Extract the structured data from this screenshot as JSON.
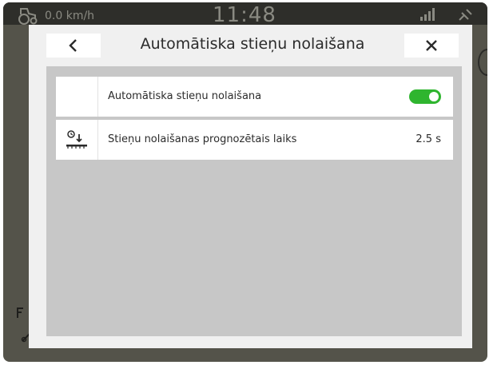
{
  "status": {
    "speed": "0.0 km/h",
    "clock": "11:48"
  },
  "dialog": {
    "title": "Automātiska stieņu nolaišana",
    "rows": [
      {
        "label": "Automātiska stieņu nolaišana",
        "toggle_on": true
      },
      {
        "label": "Stieņu nolaišanas prognozētais laiks",
        "value": "2.5 s"
      }
    ]
  },
  "colors": {
    "toggle_on": "#2fb52f",
    "dialog_bg": "#f0f0f0",
    "content_bg": "#c7c7c7"
  },
  "icons": {
    "back": "chevron-left-icon",
    "close": "close-icon",
    "row2": "boom-lowering-icon"
  }
}
